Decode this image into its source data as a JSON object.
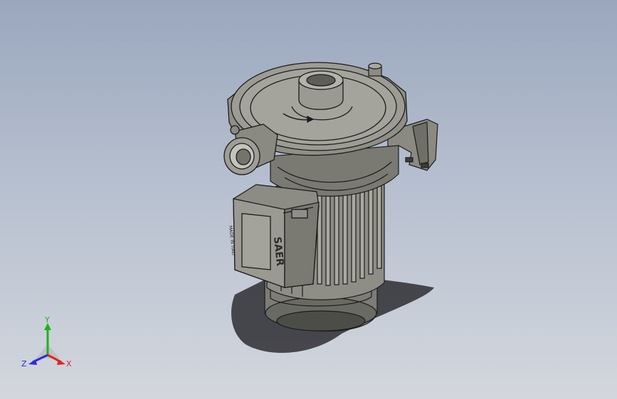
{
  "viewport": {
    "background_top": "#9aa7bd",
    "background_bottom": "#d3d7dd"
  },
  "model": {
    "name": "pump-motor-assembly",
    "body_color": "#8e8e86",
    "edge_color": "#1c1c1c",
    "shadow_color": "#2e2e33",
    "label_vertical_text": "MADE IN ITALY",
    "brand_text": "SAER"
  },
  "triad": {
    "x_label": "X",
    "y_label": "Y",
    "z_label": "Z",
    "x_color": "#e02424",
    "y_color": "#1db31d",
    "z_color": "#2a2ae0"
  }
}
